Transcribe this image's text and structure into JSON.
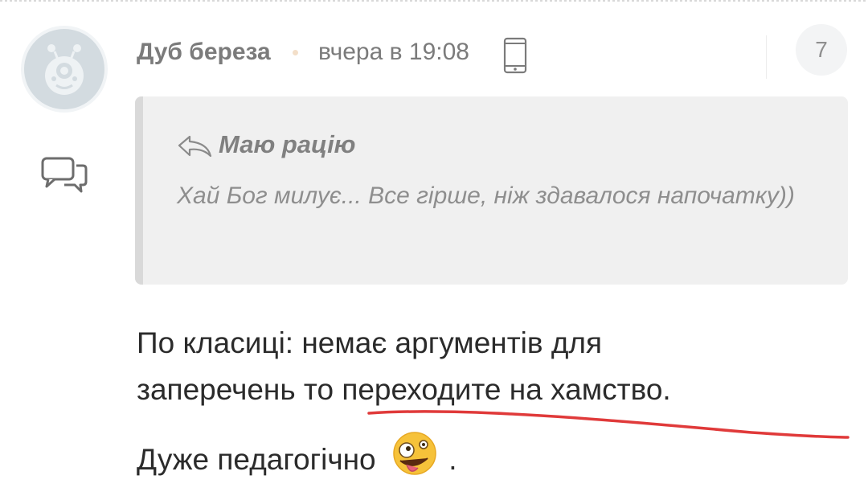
{
  "comment": {
    "author": "Дуб береза",
    "time": "вчера в 19:08",
    "reply_count": "7",
    "quote": {
      "author": "Маю рацію",
      "text": "Хай Бог милує... Все гірше, ніж здавалося напочатку))"
    },
    "body": {
      "line1": "По класиці: немає аргументів для",
      "line2": "заперечень то переходите на хамство.",
      "line3": "Дуже педагогічно",
      "line3_end": "."
    }
  },
  "icons": {
    "avatar": "avatar-creature-icon",
    "reply": "chat-bubbles-icon",
    "device": "phone-icon",
    "quote": "reply-arrow-icon",
    "emoji": "zany-face-emoji"
  },
  "colors": {
    "name_text": "#7b7b7b",
    "body_text": "#2b2b2b",
    "quote_bg": "#f0f0f0",
    "highlight_stroke": "#e03a3a"
  }
}
